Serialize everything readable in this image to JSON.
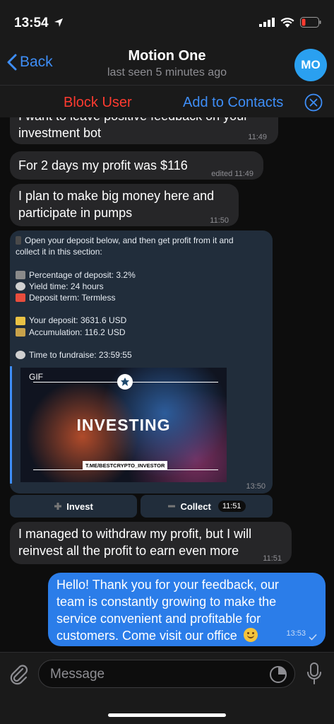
{
  "status": {
    "time": "13:54"
  },
  "nav": {
    "back_label": "Back",
    "title": "Motion One",
    "subtitle": "last seen 5 minutes ago",
    "avatar_initials": "MO"
  },
  "actions": {
    "block_label": "Block User",
    "add_label": "Add to Contacts"
  },
  "messages": [
    {
      "text": "I want to leave positive feedback on your investment bot",
      "line1": "I want to leave positive feedback on your",
      "line2": "investment bot",
      "time": "11:49"
    },
    {
      "text": "For 2 days my profit was $116",
      "time": "edited 11:49"
    },
    {
      "line1": "I plan to make big money here and",
      "line2": "participate in pumps",
      "time": "11:50"
    }
  ],
  "bot_message": {
    "intro_1": "Open your deposit below, and then get profit from it and",
    "intro_2": "collect it in this section:",
    "percentage": "Percentage of deposit: 3.2%",
    "yield_time": "Yield time: 24 hours",
    "deposit_term": "Deposit term: Termless",
    "your_deposit": "Your deposit: 3631.6 USD",
    "accumulation": "Accumulation: 116.2 USD",
    "time_to_fundraise": "Time to fundraise: 23:59:55",
    "gif_label": "GIF",
    "gif_title": "INVESTING",
    "gif_link": "T.ME/BESTCRYPTO_INVESTOR",
    "time": "13:50",
    "buttons": [
      {
        "label": "Invest",
        "icon": "plus-icon"
      },
      {
        "label": "Collect",
        "icon": "minus-icon",
        "time": "11:51"
      }
    ]
  },
  "message_4": {
    "line1": "I managed to withdraw my profit, but I will",
    "line2": "reinvest all the profit to earn even more",
    "time": "11:51"
  },
  "my_message": {
    "line1": "Hello! Thank you for your feedback, our",
    "line2": "team is constantly growing to make the",
    "line3": "service convenient and profitable for",
    "line4": "customers. Come visit our office",
    "time": "13:53"
  },
  "input": {
    "placeholder": "Message"
  },
  "colors": {
    "accent": "#3e8ef7",
    "danger": "#ff3b30",
    "outgoing": "#2b7de9",
    "incoming": "#262628",
    "bot_bg": "#212d3b"
  }
}
